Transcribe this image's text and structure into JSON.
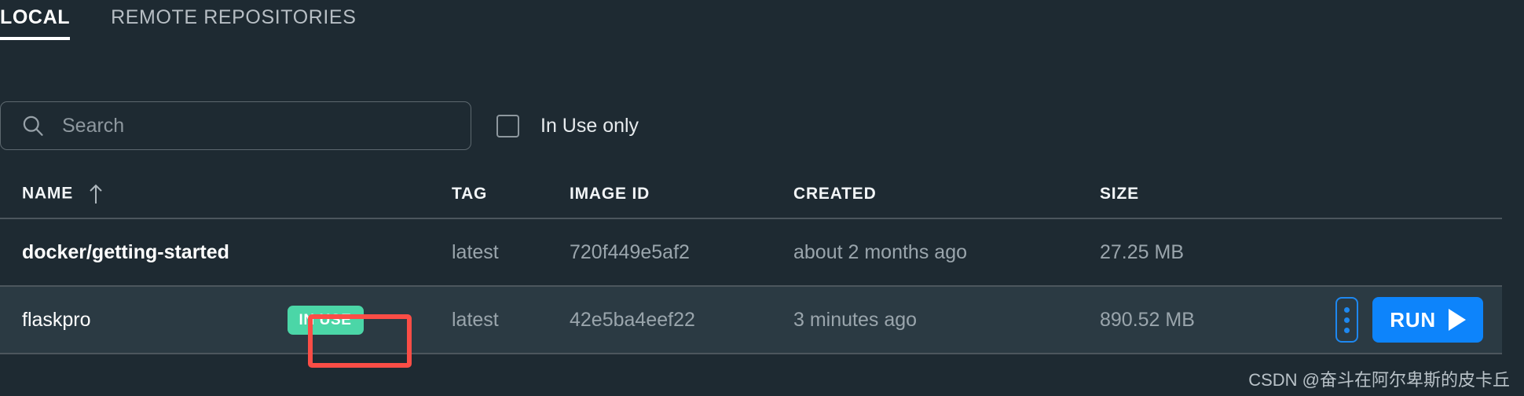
{
  "tabs": [
    {
      "label": "LOCAL",
      "active": true
    },
    {
      "label": "REMOTE REPOSITORIES",
      "active": false
    }
  ],
  "filter_bar": {
    "search": {
      "placeholder": "Search",
      "value": "",
      "icon": "search-icon"
    },
    "in_use_only": {
      "label": "In Use only",
      "checked": false
    }
  },
  "table": {
    "columns": [
      {
        "key": "name",
        "label": "NAME",
        "sort": "asc",
        "sort_icon": "arrow-up-icon"
      },
      {
        "key": "tag",
        "label": "TAG"
      },
      {
        "key": "image_id",
        "label": "IMAGE ID"
      },
      {
        "key": "created",
        "label": "CREATED"
      },
      {
        "key": "size",
        "label": "SIZE"
      }
    ],
    "rows": [
      {
        "name": "docker/getting-started",
        "badge": null,
        "tag": "latest",
        "image_id": "720f449e5af2",
        "created": "about 2 months ago",
        "size": "27.25 MB",
        "hovered": false,
        "actions": null
      },
      {
        "name": "flaskpro",
        "badge": "IN USE",
        "tag": "latest",
        "image_id": "42e5ba4eef22",
        "created": "3 minutes ago",
        "size": "890.52 MB",
        "hovered": true,
        "actions": {
          "kebab_label": "more-options",
          "run_label": "RUN"
        }
      }
    ]
  },
  "annotation": {
    "shape": "rectangle",
    "color": "#fb4d46",
    "targets": "IN USE"
  },
  "watermark": {
    "text": "CSDN @奋斗在阿尔卑斯的皮卡丘"
  },
  "colors": {
    "background": "#1e2a32",
    "row_hover": "#2b3a43",
    "divider": "#4c565d",
    "badge_green": "#4bd6a7",
    "run_blue": "#0d84fb",
    "annotation_red": "#fb4d46",
    "muted_text": "#9aa5ac"
  }
}
